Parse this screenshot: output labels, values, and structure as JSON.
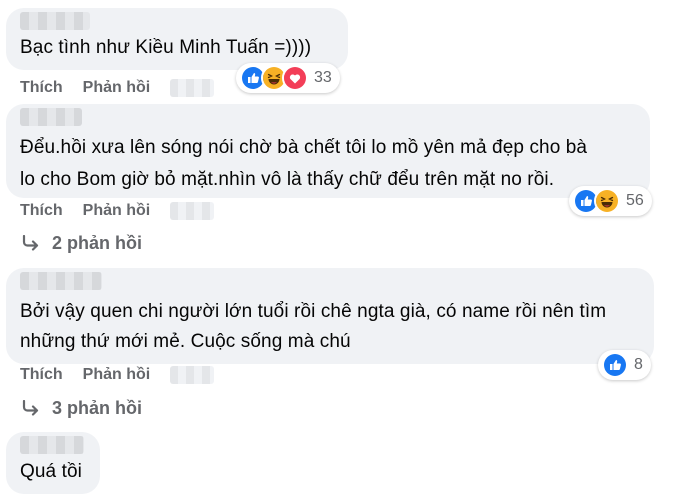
{
  "comments": [
    {
      "text_lines": [
        "Bạc tình như Kiều Minh Tuấn =))))"
      ],
      "reaction_count": "33"
    },
    {
      "text_lines": [
        "Đểu.hồi xưa lên sóng nói chờ bà chết tôi lo mồ yên mả đẹp cho bà",
        "lo cho Bom giờ bỏ mặt.nhìn vô là thấy chữ đểu trên mặt no rồi."
      ],
      "reaction_count": "56",
      "replies_label": "2 phản hồi"
    },
    {
      "text_lines": [
        "Bởi vậy quen chi người lớn tuổi rồi chê ngta già, có name rồi nên tìm",
        "những thứ mới mẻ. Cuộc sống mà chú"
      ],
      "reaction_count": "8",
      "replies_label": "3 phản hồi"
    },
    {
      "text_lines": [
        "Quá tồi"
      ]
    }
  ],
  "actions": {
    "like_label": "Thích",
    "reply_label": "Phản hồi"
  },
  "reactions": {
    "like": "like-icon",
    "haha": "haha-icon",
    "love": "love-icon"
  },
  "colors": {
    "like_blue": "#1877f2",
    "haha_yellow": "#f7b125",
    "love_red": "#f33e58",
    "bubble": "#f0f2f5",
    "meta_gray": "#65676b"
  }
}
